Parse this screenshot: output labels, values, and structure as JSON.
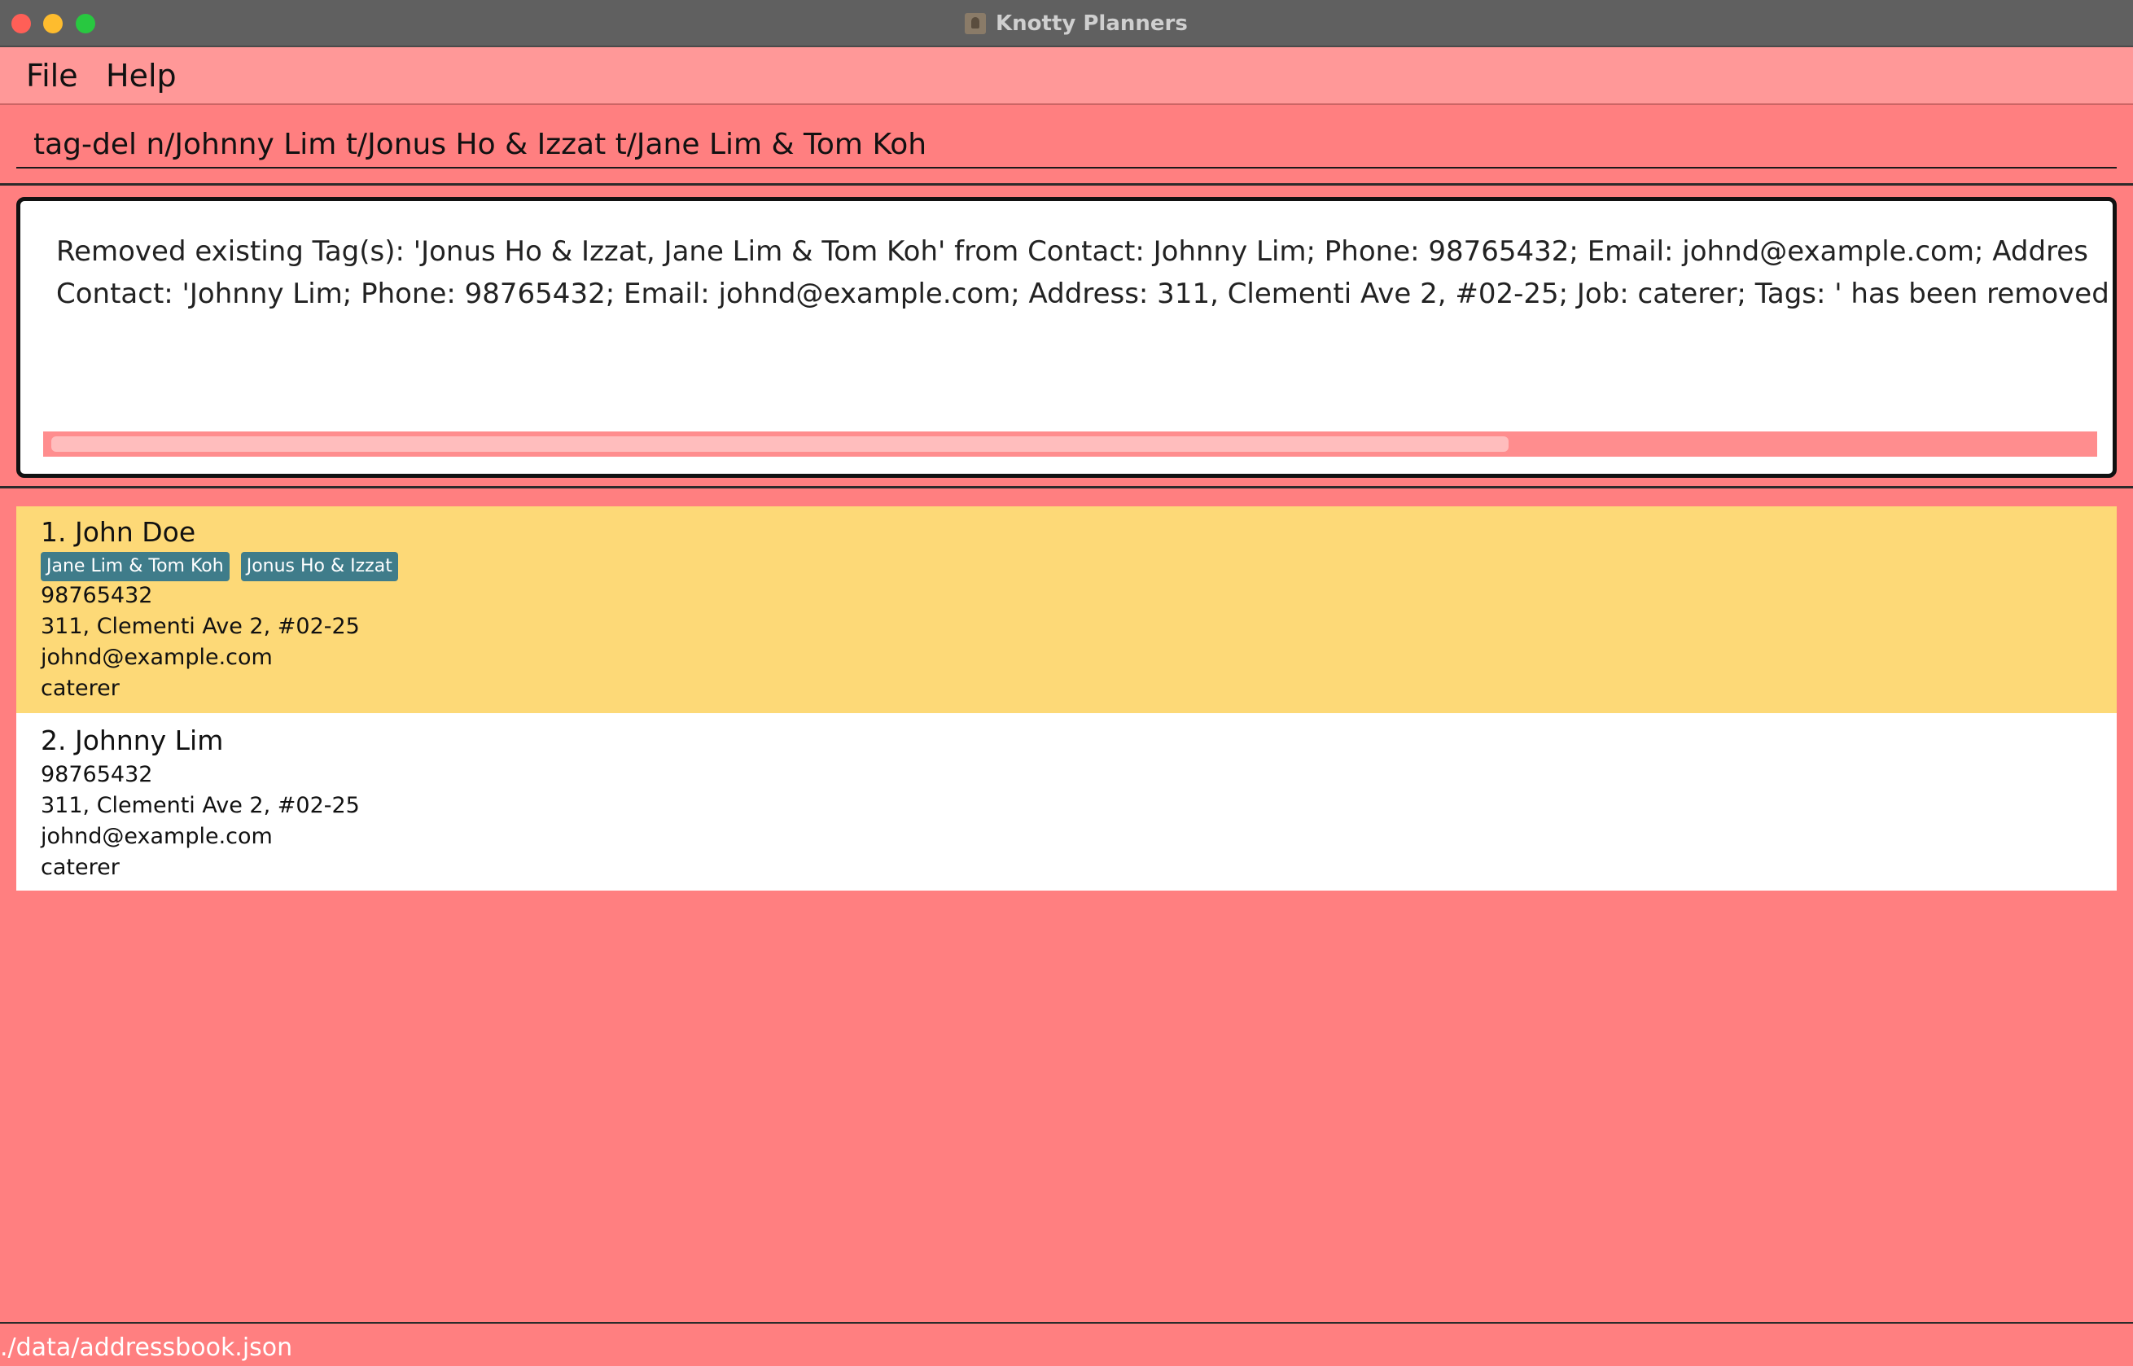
{
  "window": {
    "title": "Knotty Planners"
  },
  "menu": {
    "items": [
      {
        "label": "File"
      },
      {
        "label": "Help"
      }
    ]
  },
  "command": {
    "value": "tag-del n/Johnny Lim t/Jonus Ho & Izzat t/Jane Lim & Tom Koh"
  },
  "result": {
    "lines": [
      "Removed existing Tag(s): 'Jonus Ho & Izzat, Jane Lim & Tom Koh' from Contact: Johnny Lim; Phone: 98765432; Email: johnd@example.com; Addres",
      "Contact: 'Johnny Lim; Phone: 98765432; Email: johnd@example.com; Address: 311, Clementi Ave 2, #02-25; Job: caterer; Tags: ' has been removed"
    ],
    "scroll_fraction": 0.71
  },
  "persons": [
    {
      "index_name": "1. John Doe",
      "tags": [
        "Jane Lim & Tom Koh",
        "Jonus Ho & Izzat"
      ],
      "phone": "98765432",
      "address": "311, Clementi Ave 2, #02-25",
      "email": "johnd@example.com",
      "job": "caterer",
      "selected": true
    },
    {
      "index_name": "2. Johnny Lim",
      "tags": [],
      "phone": "98765432",
      "address": "311, Clementi Ave 2, #02-25",
      "email": "johnd@example.com",
      "job": "caterer",
      "selected": false
    }
  ],
  "status": {
    "path": "./data/addressbook.json"
  },
  "colors": {
    "background": "#ff7f80",
    "menubar": "#ff9898",
    "selected_card": "#fdd977",
    "tag": "#3f7c8a"
  }
}
